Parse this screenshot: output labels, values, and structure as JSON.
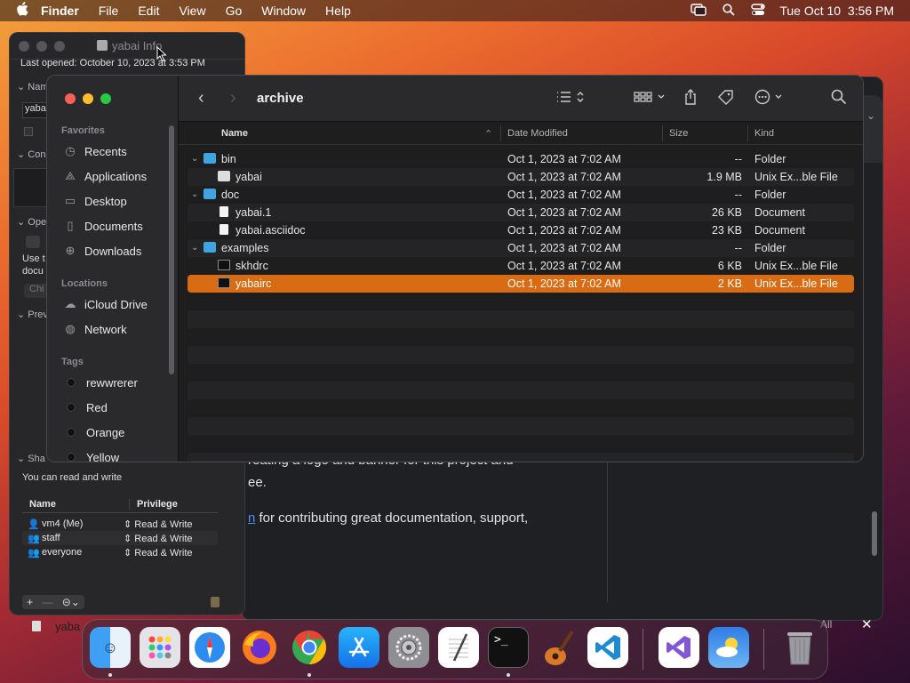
{
  "menubar": {
    "apple": "",
    "items": [
      "Finder",
      "File",
      "Edit",
      "View",
      "Go",
      "Window",
      "Help"
    ],
    "datetime": "Tue Oct 10  3:56 PM"
  },
  "bg_window": {
    "line1": "reating a logo and banner for this project and",
    "line2": "ee.",
    "line3_link": "n",
    "line3_text": " for contributing great documentation, support,",
    "bottom_right": "All",
    "close_symbol": "✕"
  },
  "info_window": {
    "title": "yabai Info",
    "last_opened": "Last opened: October 10, 2023 at 3:53 PM",
    "partial_labels": [
      "Nam",
      "yaba",
      "Con",
      "Ope",
      "Use t",
      "docu",
      "Chi",
      "Prev",
      "Sha"
    ],
    "sharing_text": "You can read and write",
    "perm_headers": {
      "name": "Name",
      "privilege": "Privilege"
    },
    "permissions": [
      {
        "name": "vm4 (Me)",
        "privilege": "Read & Write"
      },
      {
        "name": "staff",
        "privilege": "Read & Write"
      },
      {
        "name": "everyone",
        "privilege": "Read & Write"
      }
    ],
    "buttons": {
      "add": "+",
      "remove": "—",
      "action": "⊝⌄"
    },
    "bottom_file": "yaba"
  },
  "finder": {
    "title": "archive",
    "sidebar": {
      "favorites_label": "Favorites",
      "favorites": [
        "Recents",
        "Applications",
        "Desktop",
        "Documents",
        "Downloads"
      ],
      "locations_label": "Locations",
      "locations": [
        "iCloud Drive",
        "Network"
      ],
      "tags_label": "Tags",
      "tags": [
        {
          "name": "rewwrerer",
          "color": "#111111"
        },
        {
          "name": "Red",
          "color": "#111111"
        },
        {
          "name": "Orange",
          "color": "#111111"
        },
        {
          "name": "Yellow",
          "color": "#111111"
        }
      ]
    },
    "columns": {
      "name": "Name",
      "date": "Date Modified",
      "size": "Size",
      "kind": "Kind"
    },
    "rows": [
      {
        "indent": 0,
        "disclosure": "⌄",
        "icon": "folder",
        "name": "bin",
        "date": "Oct 1, 2023 at 7:02 AM",
        "size": "--",
        "kind": "Folder"
      },
      {
        "indent": 1,
        "disclosure": "",
        "icon": "exec-yabai",
        "name": "yabai",
        "date": "Oct 1, 2023 at 7:02 AM",
        "size": "1.9 MB",
        "kind": "Unix Ex...ble File"
      },
      {
        "indent": 0,
        "disclosure": "⌄",
        "icon": "folder",
        "name": "doc",
        "date": "Oct 1, 2023 at 7:02 AM",
        "size": "--",
        "kind": "Folder"
      },
      {
        "indent": 1,
        "disclosure": "",
        "icon": "document",
        "name": "yabai.1",
        "date": "Oct 1, 2023 at 7:02 AM",
        "size": "26 KB",
        "kind": "Document"
      },
      {
        "indent": 1,
        "disclosure": "",
        "icon": "document",
        "name": "yabai.asciidoc",
        "date": "Oct 1, 2023 at 7:02 AM",
        "size": "23 KB",
        "kind": "Document"
      },
      {
        "indent": 0,
        "disclosure": "⌄",
        "icon": "folder",
        "name": "examples",
        "date": "Oct 1, 2023 at 7:02 AM",
        "size": "--",
        "kind": "Folder"
      },
      {
        "indent": 1,
        "disclosure": "",
        "icon": "exec",
        "name": "skhdrc",
        "date": "Oct 1, 2023 at 7:02 AM",
        "size": "6 KB",
        "kind": "Unix Ex...ble File"
      },
      {
        "indent": 1,
        "disclosure": "",
        "icon": "exec",
        "name": "yabairc",
        "date": "Oct 1, 2023 at 7:02 AM",
        "size": "2 KB",
        "kind": "Unix Ex...ble File",
        "selected": true
      }
    ],
    "selection_color": "#d96b12"
  },
  "dock": {
    "apps": [
      "finder-icon",
      "launchpad-icon",
      "safari-icon",
      "firefox-icon",
      "chrome-icon",
      "app-store-icon",
      "system-settings-icon",
      "textedit-icon",
      "terminal-icon",
      "garageband-icon",
      "vscode-icon",
      "visual-studio-icon",
      "weather-icon",
      "trash-icon"
    ]
  }
}
